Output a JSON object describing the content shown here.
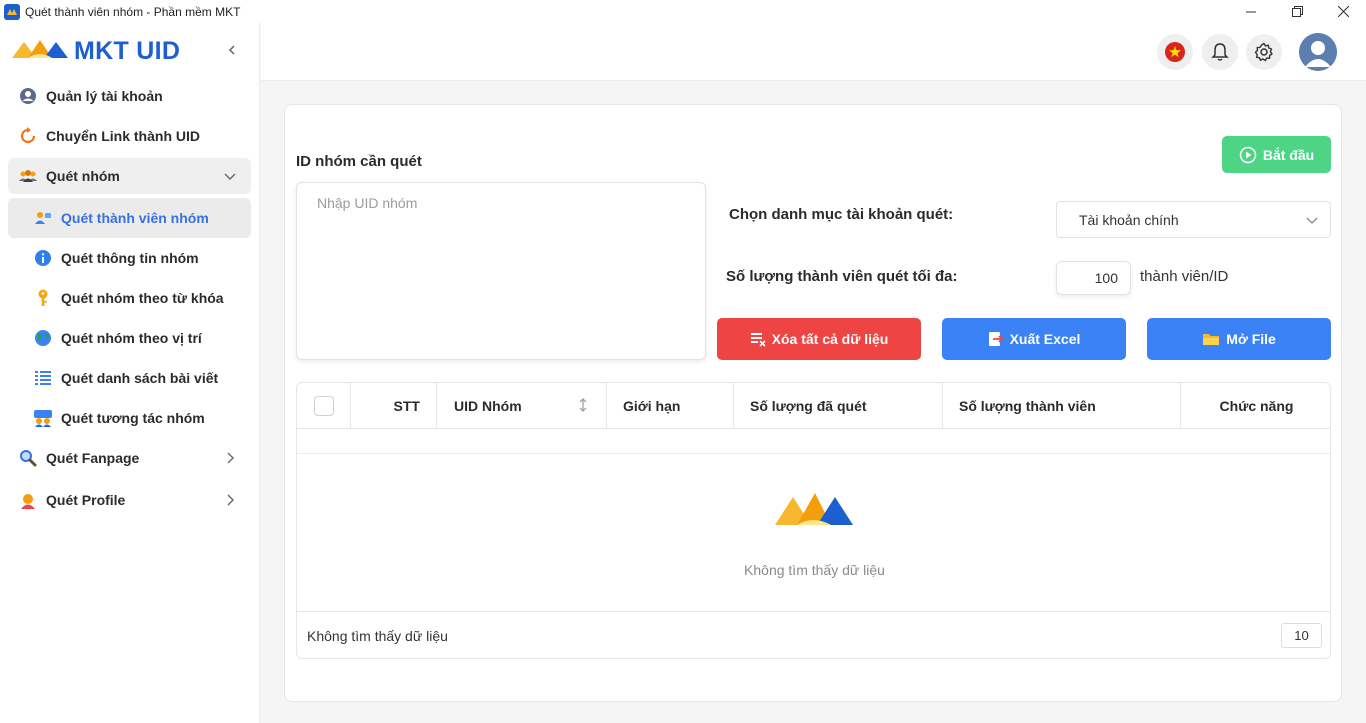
{
  "window": {
    "title": "Quét thành viên nhóm - Phần mềm MKT"
  },
  "sidebar": {
    "logo_text": "MKT UID",
    "items": [
      {
        "label": "Quản lý tài khoản",
        "icon": "user-circle-icon"
      },
      {
        "label": "Chuyển Link thành UID",
        "icon": "refresh-icon"
      },
      {
        "label": "Quét nhóm",
        "icon": "group-icon",
        "expanded": true
      },
      {
        "label": "Quét Fanpage",
        "icon": "search-icon"
      },
      {
        "label": "Quét Profile",
        "icon": "profile-icon"
      }
    ],
    "sub_items": [
      {
        "label": "Quét thành viên nhóm",
        "icon": "members-icon",
        "active": true
      },
      {
        "label": "Quét thông tin nhóm",
        "icon": "info-icon"
      },
      {
        "label": "Quét nhóm theo từ khóa",
        "icon": "key-icon"
      },
      {
        "label": "Quét nhóm theo vị trí",
        "icon": "globe-icon"
      },
      {
        "label": "Quét danh sách bài viết",
        "icon": "list-icon"
      },
      {
        "label": "Quét tương tác nhóm",
        "icon": "interaction-icon"
      }
    ]
  },
  "header": {
    "icons": [
      "vietnam-flag-icon",
      "bell-icon",
      "gear-icon",
      "avatar-icon"
    ]
  },
  "form": {
    "uid_label": "ID nhóm cần quét",
    "uid_placeholder": "Nhập UID nhóm",
    "start_label": "Bắt đầu",
    "category_label": "Chọn danh mục tài khoản quét:",
    "category_value": "Tài khoản chính",
    "max_label": "Số lượng thành viên quét tối đa:",
    "max_value": "100",
    "max_unit": "thành viên/ID",
    "clear_label": "Xóa tất cả dữ liệu",
    "export_label": "Xuất Excel",
    "open_label": "Mở File"
  },
  "table": {
    "columns": [
      "STT",
      "UID Nhóm",
      "Giới hạn",
      "Số lượng đã quét",
      "Số lượng thành viên",
      "Chức năng"
    ],
    "empty_text": "Không tìm thấy dữ liệu",
    "footer_text": "Không tìm thấy dữ liệu",
    "page_size": "10"
  },
  "colors": {
    "brand_blue": "#1d5fd1",
    "start_green": "#4dd485",
    "danger_red": "#ef4444",
    "action_blue": "#3b82f6",
    "active_text": "#3b6fe0"
  }
}
